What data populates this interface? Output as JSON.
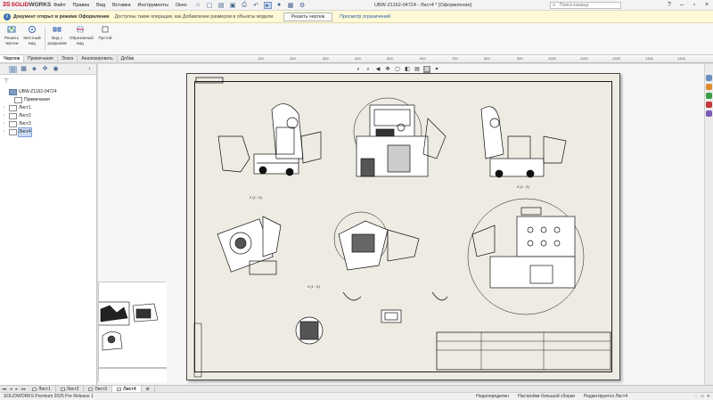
{
  "app": {
    "logo_ds": "3S",
    "logo_text1": "SOLID",
    "logo_text2": "WORKS",
    "window_title": "UBW-Z1162-04724 - Лист4 * [Оформление]",
    "search_placeholder": "Поиск команд"
  },
  "menu": [
    "Файл",
    "Правка",
    "Вид",
    "Вставка",
    "Инструменты",
    "Окно"
  ],
  "quick_access_icons": [
    "home-icon",
    "new-icon",
    "open-icon",
    "save-icon",
    "print-icon",
    "undo-icon",
    "select-icon",
    "rebuild-icon",
    "options-icon"
  ],
  "infobar": {
    "title": "Документ открыт в режиме Оформление",
    "message": "Доступны такие операции, как Добавление размеров в объекты модели.",
    "button": "Решить чертеж",
    "link": "Просмотр ограничений"
  },
  "ribbon": [
    {
      "label": "Решить чертеж",
      "icon": "resolve-drawing-icon"
    },
    {
      "label": "Местный вид",
      "icon": "detail-view-icon"
    },
    {
      "label": "Вид с разрывом",
      "icon": "broken-view-icon"
    },
    {
      "label": "Обрезанный вид",
      "icon": "crop-view-icon"
    },
    {
      "label": "Пустой",
      "icon": "empty-view-icon"
    }
  ],
  "command_tabs": [
    "Чертеж",
    "Примечание",
    "Эскиз",
    "Анализировать",
    "Добавления SOLIDWORKS"
  ],
  "ruler_numbers": [
    "100",
    "200",
    "300",
    "400",
    "500",
    "600",
    "700",
    "800",
    "900",
    "1000",
    "1100",
    "1200",
    "1300",
    "1400"
  ],
  "tree": {
    "root": "UBW-Z1162-04724",
    "annotations": "Примечания",
    "sheets": [
      "Лист1",
      "Лист2",
      "Лист3",
      "Лист4"
    ]
  },
  "sheet_tabs": [
    "Лист1",
    "Лист2",
    "Лист3",
    "Лист4"
  ],
  "status": {
    "left": "SOLIDWORKS Premium 2025 Pre Release 1",
    "items": [
      "Недоопределен",
      "Настройки большой сборки",
      "Редактируется Лист4"
    ]
  }
}
